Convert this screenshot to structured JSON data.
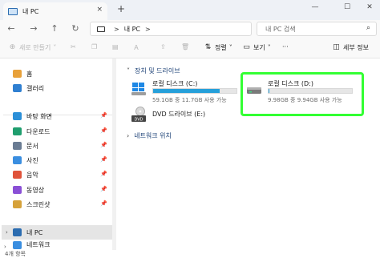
{
  "window": {
    "tab_title": "내 PC",
    "tab_close": "×",
    "new_tab": "+",
    "minimize": "—",
    "maximize": "☐",
    "close": "✕"
  },
  "nav": {
    "back": "←",
    "forward": "→",
    "up": "↑",
    "refresh": "↻",
    "breadcrumb": [
      "내 PC"
    ],
    "breadcrumb_sep": ">",
    "search_placeholder": "내 PC 검색",
    "search_icon": "search-icon"
  },
  "toolbar": {
    "new_label": "새로 만들기",
    "sort_label": "정렬",
    "view_label": "보기",
    "details_label": "세부 정보",
    "more": "···"
  },
  "sidebar": {
    "items": [
      {
        "label": "홈",
        "icon": "home-icon",
        "color": "#e8a13a",
        "pinned": false
      },
      {
        "label": "갤러리",
        "icon": "gallery-icon",
        "color": "#2f7fd1",
        "pinned": false
      },
      {
        "label": "바탕 화면",
        "icon": "desktop-icon",
        "color": "#2b8fd8",
        "pinned": true
      },
      {
        "label": "다운로드",
        "icon": "download-icon",
        "color": "#1f9e6e",
        "pinned": true
      },
      {
        "label": "문서",
        "icon": "documents-icon",
        "color": "#6a7c93",
        "pinned": true
      },
      {
        "label": "사진",
        "icon": "pictures-icon",
        "color": "#3a8ee0",
        "pinned": true
      },
      {
        "label": "음악",
        "icon": "music-icon",
        "color": "#e0533a",
        "pinned": true
      },
      {
        "label": "동영상",
        "icon": "videos-icon",
        "color": "#8a4fd6",
        "pinned": true
      },
      {
        "label": "스크린샷",
        "icon": "screenshots-icon",
        "color": "#d6a23a",
        "pinned": true
      }
    ],
    "this_pc": "내 PC",
    "network": "네트워크"
  },
  "content": {
    "group_drives": "장치 및 드라이브",
    "group_network": "네트워크 위치",
    "drives": [
      {
        "name": "로컬 디스크 (C:)",
        "info": "59.1GB 중 11.7GB 사용 가능",
        "used_fraction": 0.8,
        "icon": "windows-drive-icon"
      },
      {
        "name": "로컬 디스크 (D:)",
        "info": "9.98GB 중 9.94GB 사용 가능",
        "used_fraction": 0.004,
        "icon": "hard-drive-icon"
      }
    ],
    "dvd": {
      "name": "DVD 드라이브 (E:)",
      "badge": "DVD",
      "icon": "dvd-drive-icon"
    },
    "highlight_color": "#33ff33"
  },
  "status": {
    "items_count": "4개 항목"
  }
}
